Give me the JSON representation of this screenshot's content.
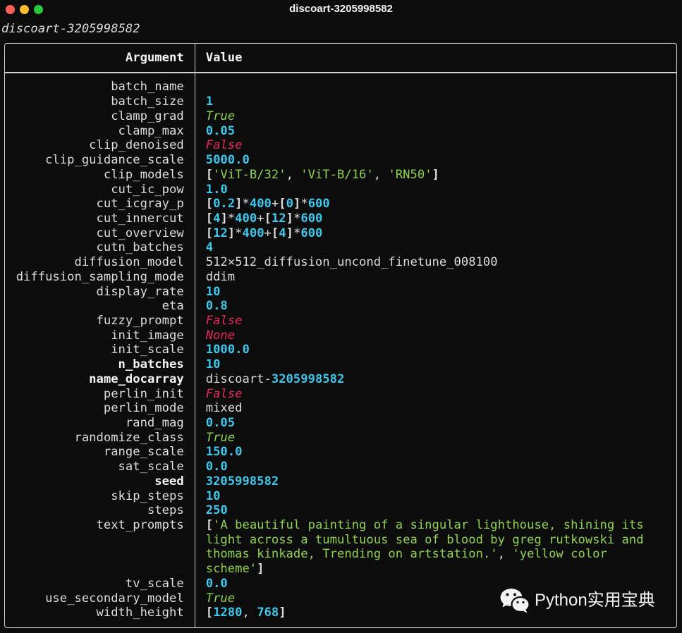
{
  "window": {
    "title": "discoart-3205998582",
    "controls": {
      "close_color": "#ff5f57",
      "minimize_color": "#febc2e",
      "zoom_color": "#28c840"
    }
  },
  "colors": {
    "background": "#0c0c0c",
    "text": "#dcdcdc",
    "border": "#d2d2d2",
    "bold_text": "#f5f5f5"
  },
  "terminal": {
    "heading": "discoart-3205998582",
    "table": {
      "columns": [
        "Argument",
        "Value"
      ],
      "rows": [
        {
          "argument": "batch_name",
          "value": []
        },
        {
          "argument": "batch_size",
          "value": [
            {
              "text": "1",
              "color": "#3fc6ea",
              "bold": true
            }
          ]
        },
        {
          "argument": "clamp_grad",
          "value": [
            {
              "text": "True",
              "color": "#8fd24f",
              "italic": true
            }
          ]
        },
        {
          "argument": "clamp_max",
          "value": [
            {
              "text": "0.05",
              "color": "#3fc6ea",
              "bold": true
            }
          ]
        },
        {
          "argument": "clip_denoised",
          "value": [
            {
              "text": "False",
              "color": "#e42a5f",
              "italic": true
            }
          ]
        },
        {
          "argument": "clip_guidance_scale",
          "value": [
            {
              "text": "5000.0",
              "color": "#3fc6ea",
              "bold": true
            }
          ]
        },
        {
          "argument": "clip_models",
          "value": [
            {
              "text": "[",
              "bold": true
            },
            {
              "text": "'ViT-B/32'",
              "color": "#8fd24f"
            },
            {
              "text": ", "
            },
            {
              "text": "'ViT-B/16'",
              "color": "#8fd24f"
            },
            {
              "text": ", "
            },
            {
              "text": "'RN50'",
              "color": "#8fd24f"
            },
            {
              "text": "]",
              "bold": true
            }
          ]
        },
        {
          "argument": "cut_ic_pow",
          "value": [
            {
              "text": "1.0",
              "color": "#3fc6ea",
              "bold": true
            }
          ]
        },
        {
          "argument": "cut_icgray_p",
          "value": [
            {
              "text": "[",
              "bold": true
            },
            {
              "text": "0.2",
              "color": "#3fc6ea",
              "bold": true
            },
            {
              "text": "]",
              "bold": true
            },
            {
              "text": "*"
            },
            {
              "text": "400",
              "color": "#3fc6ea",
              "bold": true
            },
            {
              "text": "+"
            },
            {
              "text": "[",
              "bold": true
            },
            {
              "text": "0",
              "color": "#3fc6ea",
              "bold": true
            },
            {
              "text": "]",
              "bold": true
            },
            {
              "text": "*"
            },
            {
              "text": "600",
              "color": "#3fc6ea",
              "bold": true
            }
          ]
        },
        {
          "argument": "cut_innercut",
          "value": [
            {
              "text": "[",
              "bold": true
            },
            {
              "text": "4",
              "color": "#3fc6ea",
              "bold": true
            },
            {
              "text": "]",
              "bold": true
            },
            {
              "text": "*"
            },
            {
              "text": "400",
              "color": "#3fc6ea",
              "bold": true
            },
            {
              "text": "+"
            },
            {
              "text": "[",
              "bold": true
            },
            {
              "text": "12",
              "color": "#3fc6ea",
              "bold": true
            },
            {
              "text": "]",
              "bold": true
            },
            {
              "text": "*"
            },
            {
              "text": "600",
              "color": "#3fc6ea",
              "bold": true
            }
          ]
        },
        {
          "argument": "cut_overview",
          "value": [
            {
              "text": "[",
              "bold": true
            },
            {
              "text": "12",
              "color": "#3fc6ea",
              "bold": true
            },
            {
              "text": "]",
              "bold": true
            },
            {
              "text": "*"
            },
            {
              "text": "400",
              "color": "#3fc6ea",
              "bold": true
            },
            {
              "text": "+"
            },
            {
              "text": "[",
              "bold": true
            },
            {
              "text": "4",
              "color": "#3fc6ea",
              "bold": true
            },
            {
              "text": "]",
              "bold": true
            },
            {
              "text": "*"
            },
            {
              "text": "600",
              "color": "#3fc6ea",
              "bold": true
            }
          ]
        },
        {
          "argument": "cutn_batches",
          "value": [
            {
              "text": "4",
              "color": "#3fc6ea",
              "bold": true
            }
          ]
        },
        {
          "argument": "diffusion_model",
          "value": [
            {
              "text": "512×512_diffusion_uncond_finetune_008100"
            }
          ]
        },
        {
          "argument": "diffusion_sampling_mode",
          "value": [
            {
              "text": "ddim"
            }
          ]
        },
        {
          "argument": "display_rate",
          "value": [
            {
              "text": "10",
              "color": "#3fc6ea",
              "bold": true
            }
          ]
        },
        {
          "argument": "eta",
          "value": [
            {
              "text": "0.8",
              "color": "#3fc6ea",
              "bold": true
            }
          ]
        },
        {
          "argument": "fuzzy_prompt",
          "value": [
            {
              "text": "False",
              "color": "#e42a5f",
              "italic": true
            }
          ]
        },
        {
          "argument": "init_image",
          "value": [
            {
              "text": "None",
              "color": "#e42a5f",
              "italic": true
            }
          ]
        },
        {
          "argument": "init_scale",
          "value": [
            {
              "text": "1000.0",
              "color": "#3fc6ea",
              "bold": true
            }
          ]
        },
        {
          "argument": "n_batches",
          "bold": true,
          "value": [
            {
              "text": "10",
              "color": "#3fc6ea",
              "bold": true
            }
          ]
        },
        {
          "argument": "name_docarray",
          "bold": true,
          "value": [
            {
              "text": "discoart-"
            },
            {
              "text": "3205998582",
              "color": "#3fc6ea",
              "bold": true
            }
          ]
        },
        {
          "argument": "perlin_init",
          "value": [
            {
              "text": "False",
              "color": "#e42a5f",
              "italic": true
            }
          ]
        },
        {
          "argument": "perlin_mode",
          "value": [
            {
              "text": "mixed"
            }
          ]
        },
        {
          "argument": "rand_mag",
          "value": [
            {
              "text": "0.05",
              "color": "#3fc6ea",
              "bold": true
            }
          ]
        },
        {
          "argument": "randomize_class",
          "value": [
            {
              "text": "True",
              "color": "#8fd24f",
              "italic": true
            }
          ]
        },
        {
          "argument": "range_scale",
          "value": [
            {
              "text": "150.0",
              "color": "#3fc6ea",
              "bold": true
            }
          ]
        },
        {
          "argument": "sat_scale",
          "value": [
            {
              "text": "0.0",
              "color": "#3fc6ea",
              "bold": true
            }
          ]
        },
        {
          "argument": "seed",
          "bold": true,
          "value": [
            {
              "text": "3205998582",
              "color": "#3fc6ea",
              "bold": true
            }
          ]
        },
        {
          "argument": "skip_steps",
          "value": [
            {
              "text": "10",
              "color": "#3fc6ea",
              "bold": true
            }
          ]
        },
        {
          "argument": "steps",
          "value": [
            {
              "text": "250",
              "color": "#3fc6ea",
              "bold": true
            }
          ]
        },
        {
          "argument": "text_prompts",
          "value": [
            {
              "text": "[",
              "bold": true
            },
            {
              "text": "'A beautiful painting of a singular lighthouse, shining its light across a tumultuous sea of blood by greg rutkowski and thomas kinkade, Trending on artstation.'",
              "color": "#8fd24f"
            },
            {
              "text": ", "
            },
            {
              "text": "'yellow color scheme'",
              "color": "#8fd24f"
            },
            {
              "text": "]",
              "bold": true
            }
          ]
        },
        {
          "argument": "tv_scale",
          "value": [
            {
              "text": "0.0",
              "color": "#3fc6ea",
              "bold": true
            }
          ]
        },
        {
          "argument": "use_secondary_model",
          "value": [
            {
              "text": "True",
              "color": "#8fd24f",
              "italic": true
            }
          ]
        },
        {
          "argument": "width_height",
          "value": [
            {
              "text": "[",
              "bold": true
            },
            {
              "text": "1280",
              "color": "#3fc6ea",
              "bold": true
            },
            {
              "text": ", "
            },
            {
              "text": "768",
              "color": "#3fc6ea",
              "bold": true
            },
            {
              "text": "]",
              "bold": true
            }
          ]
        }
      ]
    }
  },
  "watermark": {
    "icon": "wechat-icon",
    "text": "Python实用宝典"
  }
}
